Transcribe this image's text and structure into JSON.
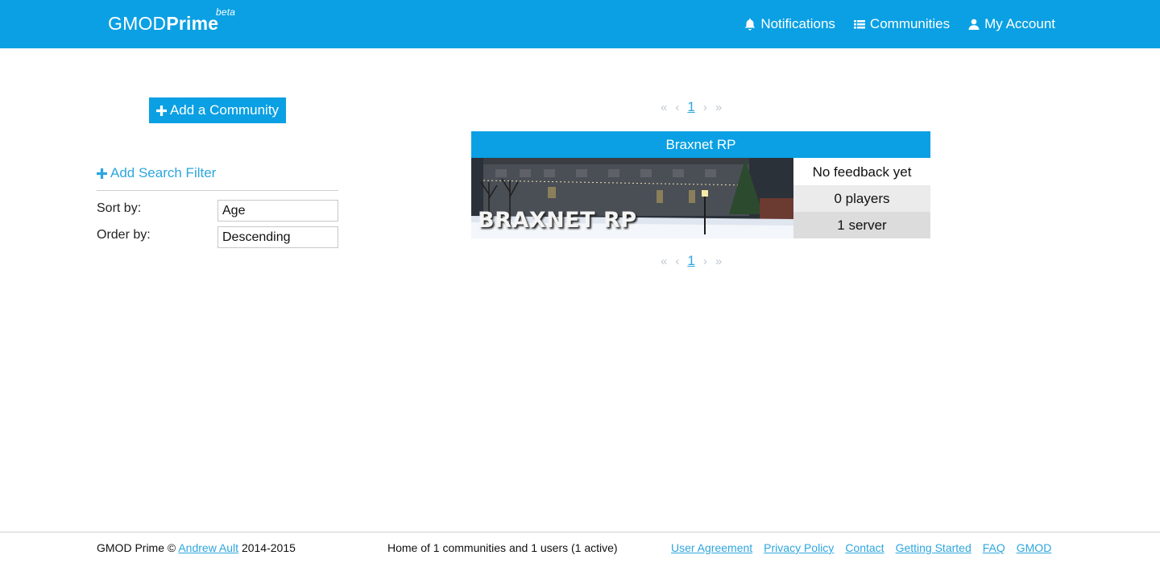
{
  "header": {
    "brand_light": "GMOD",
    "brand_bold": "Prime",
    "brand_tag": "beta",
    "nav": {
      "notifications": "Notifications",
      "communities": "Communities",
      "account": "My Account"
    }
  },
  "sidebar": {
    "add_community": "Add a Community",
    "add_filter": "Add Search Filter",
    "sort_label": "Sort by:",
    "sort_value": "Age",
    "order_label": "Order by:",
    "order_value": "Descending"
  },
  "pagination": {
    "page": "1"
  },
  "community": {
    "name": "Braxnet RP",
    "banner_text": "BRAXNET RP",
    "feedback": "No feedback yet",
    "players": "0 players",
    "servers": "1 server"
  },
  "footer": {
    "copyright_prefix": "GMOD Prime ©",
    "author": "Andrew Ault",
    "years": "2014-2015",
    "stats": "Home of 1 communities and 1 users (1 active)",
    "links": [
      "User Agreement",
      "Privacy Policy",
      "Contact",
      "Getting Started",
      "FAQ",
      "GMOD"
    ]
  },
  "colors": {
    "accent": "#0aa0e3",
    "link": "#2da6de"
  },
  "icons": [
    "bell-icon",
    "list-icon",
    "user-icon",
    "plus-icon",
    "double-left-icon",
    "left-icon",
    "right-icon",
    "double-right-icon"
  ]
}
